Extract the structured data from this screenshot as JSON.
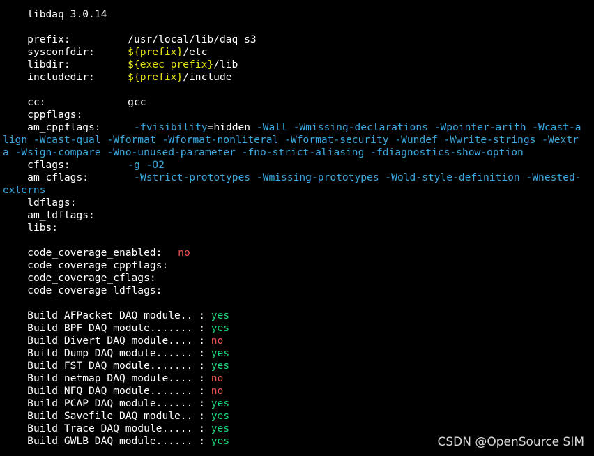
{
  "terminal": {
    "header": "libdaq 3.0.14",
    "prefix": {
      "label": "prefix:",
      "value": "/usr/local/lib/daq_s3"
    },
    "sysconfdir": {
      "label": "sysconfdir:",
      "var": "${prefix}",
      "rest": "/etc"
    },
    "libdir": {
      "label": "libdir:",
      "var": "${exec_prefix}",
      "rest": "/lib"
    },
    "includedir": {
      "label": "includedir:",
      "var": "${prefix}",
      "rest": "/include"
    },
    "cc": {
      "label": "cc:",
      "value": "gcc"
    },
    "cppflags": {
      "label": "cppflags:"
    },
    "am_cppflags": {
      "label": "am_cppflags:",
      "line1_a": "-fvisibility",
      "line1_b": "=hidden ",
      "line1_c": "-Wall -Wmissing-declarations -Wpointer-arith -Wcast-a",
      "line2": "lign -Wcast-qual -Wformat -Wformat-nonliteral -Wformat-security -Wundef -Wwrite-strings -Wextr",
      "line3": "a -Wsign-compare -Wno-unused-parameter -fno-strict-aliasing -fdiagnostics-show-option"
    },
    "cflags": {
      "label": "cflags:",
      "value": "-g -O2"
    },
    "am_cflags": {
      "label": "am_cflags:",
      "line1": "-Wstrict-prototypes -Wmissing-prototypes -Wold-style-definition -Wnested-",
      "line2": "externs"
    },
    "ldflags": {
      "label": "ldflags:"
    },
    "am_ldflags": {
      "label": "am_ldflags:"
    },
    "libs": {
      "label": "libs:"
    },
    "code_coverage_enabled": {
      "label": "code_coverage_enabled:",
      "value": "no"
    },
    "code_coverage_cppflags": {
      "label": "code_coverage_cppflags:"
    },
    "code_coverage_cflags": {
      "label": "code_coverage_cflags:"
    },
    "code_coverage_ldflags": {
      "label": "code_coverage_ldflags:"
    },
    "modules": [
      {
        "label": "Build AFPacket DAQ module.. : ",
        "value": "yes"
      },
      {
        "label": "Build BPF DAQ module....... : ",
        "value": "yes"
      },
      {
        "label": "Build Divert DAQ module.... : ",
        "value": "no"
      },
      {
        "label": "Build Dump DAQ module...... : ",
        "value": "yes"
      },
      {
        "label": "Build FST DAQ module....... : ",
        "value": "yes"
      },
      {
        "label": "Build netmap DAQ module.... : ",
        "value": "no"
      },
      {
        "label": "Build NFQ DAQ module....... : ",
        "value": "no"
      },
      {
        "label": "Build PCAP DAQ module...... : ",
        "value": "yes"
      },
      {
        "label": "Build Savefile DAQ module.. : ",
        "value": "yes"
      },
      {
        "label": "Build Trace DAQ module..... : ",
        "value": "yes"
      },
      {
        "label": "Build GWLB DAQ module...... : ",
        "value": "yes"
      }
    ],
    "colors": {
      "background": "#000000",
      "text": "#ffffff",
      "variable": "#e5e510",
      "flag": "#3aa8de",
      "yes": "#17d679",
      "no": "#ef5350"
    }
  },
  "watermark": "CSDN @OpenSource SIM"
}
